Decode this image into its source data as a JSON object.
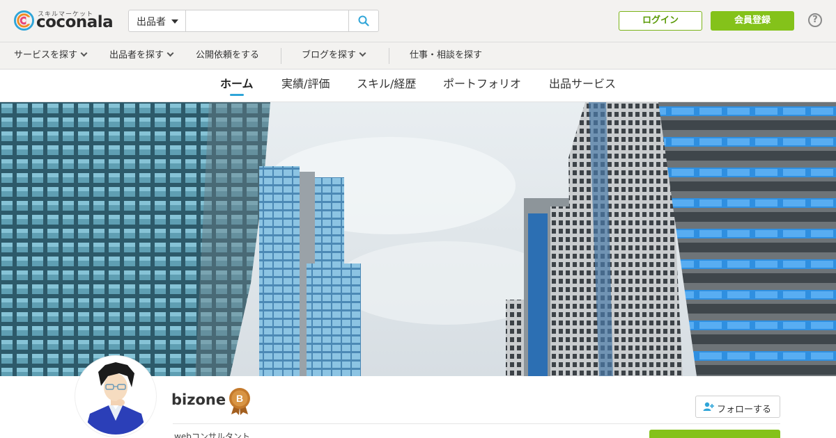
{
  "header": {
    "logo": {
      "tagline": "スキルマーケット",
      "wordmark": "coconala",
      "mark_icon": "coconala-logo-icon"
    },
    "search": {
      "scope_selected": "出品者",
      "placeholder": "",
      "button_icon": "search-icon"
    },
    "login_label": "ログイン",
    "register_label": "会員登録",
    "help_glyph": "?"
  },
  "category_nav": {
    "items": [
      {
        "label": "サービスを探す",
        "dropdown": true
      },
      {
        "label": "出品者を探す",
        "dropdown": true
      },
      {
        "label": "公開依頼をする",
        "dropdown": false
      },
      {
        "label": "ブログを探す",
        "dropdown": true
      },
      {
        "label": "仕事・相談を探す",
        "dropdown": false
      }
    ]
  },
  "profile_tabs": {
    "items": [
      {
        "label": "ホーム",
        "active": true
      },
      {
        "label": "実績/評価",
        "active": false
      },
      {
        "label": "スキル/経歴",
        "active": false
      },
      {
        "label": "ポートフォリオ",
        "active": false
      },
      {
        "label": "出品サービス",
        "active": false
      }
    ]
  },
  "profile": {
    "username": "bizone",
    "rank_badge": "B",
    "follow_label": "フォローする",
    "tagline": "webコンサルタント"
  },
  "colors": {
    "brand_green": "#84c21a",
    "accent_blue": "#2fa5d8",
    "badge_bronze": "#c47a2c"
  }
}
